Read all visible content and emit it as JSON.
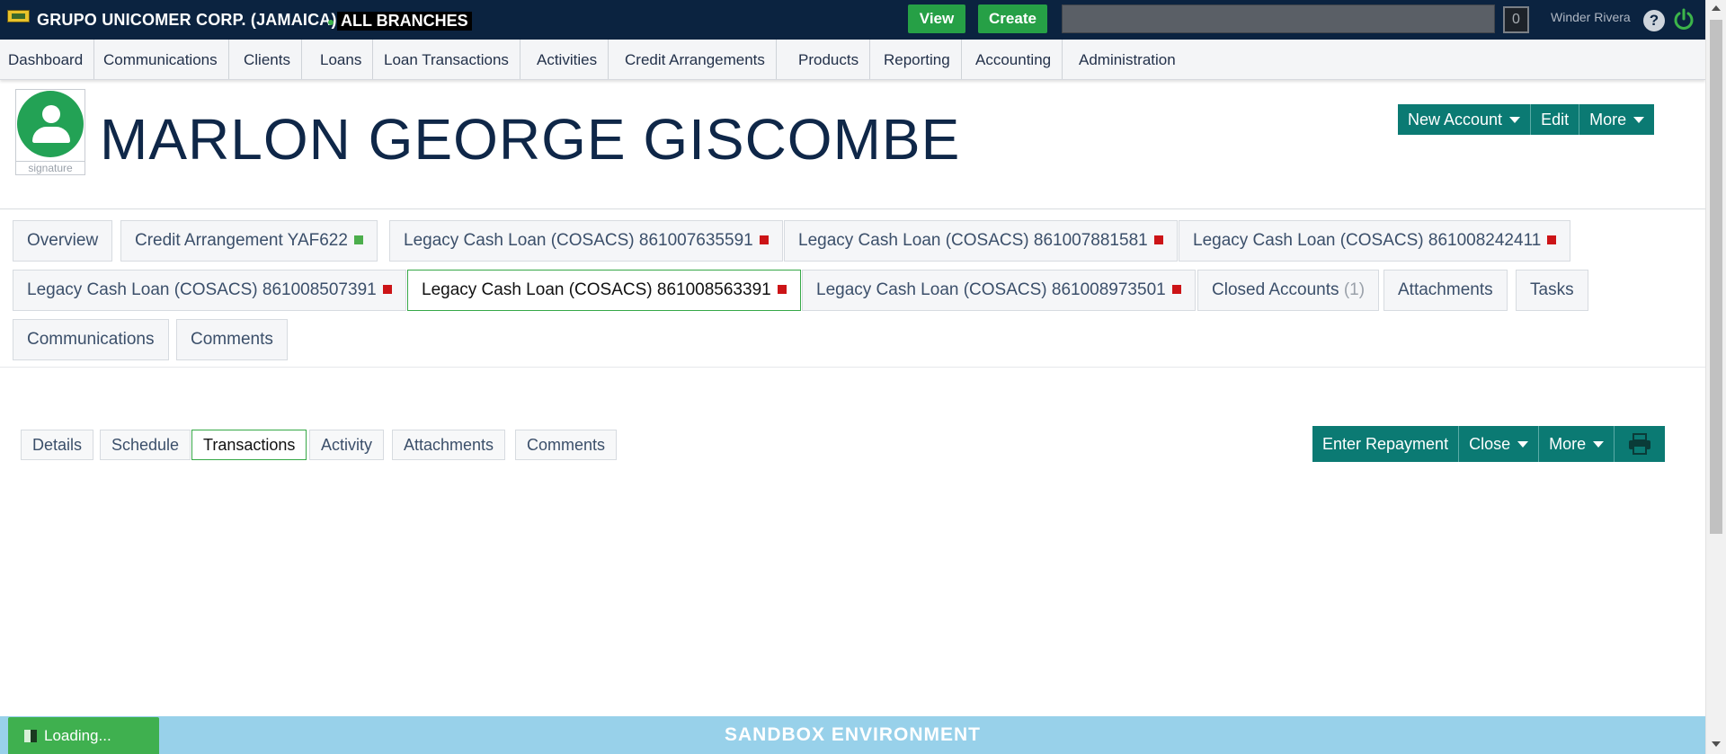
{
  "topbar": {
    "company": "GRUPO UNICOMER CORP. (JAMAICA)",
    "branch": "ALL BRANCHES",
    "view_label": "View",
    "create_label": "Create",
    "search_value": "",
    "counter": "0",
    "user": "Winder Rivera",
    "help_glyph": "?"
  },
  "menu": {
    "items": [
      "Dashboard",
      "Communications",
      "Clients",
      "Loans",
      "Loan Transactions",
      "Activities",
      "Credit Arrangements",
      "Products",
      "Reporting",
      "Accounting",
      "Administration"
    ]
  },
  "client": {
    "name": "MARLON GEORGE GISCOMBE",
    "signature_label": "signature",
    "actions": [
      "New Account",
      "Edit",
      "More"
    ]
  },
  "account_tabs": [
    {
      "label": "Overview",
      "marker": ""
    },
    {
      "label": "Credit Arrangement YAF622",
      "marker": "green"
    },
    {
      "label": "Legacy Cash Loan (COSACS) 861007635591",
      "marker": "red"
    },
    {
      "label": "Legacy Cash Loan (COSACS) 861007881581",
      "marker": "red"
    },
    {
      "label": "Legacy Cash Loan (COSACS) 861008242411",
      "marker": "red"
    },
    {
      "label": "Legacy Cash Loan (COSACS) 861008507391",
      "marker": "red"
    },
    {
      "label": "Legacy Cash Loan (COSACS) 861008563391",
      "marker": "red",
      "active": true
    },
    {
      "label": "Legacy Cash Loan (COSACS) 861008973501",
      "marker": "red"
    },
    {
      "label": "Closed Accounts",
      "count": "(1)"
    },
    {
      "label": "Attachments"
    },
    {
      "label": "Tasks"
    },
    {
      "label": "Communications"
    },
    {
      "label": "Comments"
    }
  ],
  "sub_tabs": [
    "Details",
    "Schedule",
    "Transactions",
    "Activity",
    "Attachments",
    "Comments"
  ],
  "active_sub_tab": "Transactions",
  "loan_actions": [
    "Enter Repayment",
    "Close",
    "More"
  ],
  "footer": {
    "environment": "SANDBOX ENVIRONMENT",
    "loading": "Loading..."
  },
  "colors": {
    "topbar": "#0b2340",
    "accent_teal": "#0b7a73",
    "green": "#26a046",
    "status_red": "#cc1417",
    "footer": "#98d1ea"
  }
}
